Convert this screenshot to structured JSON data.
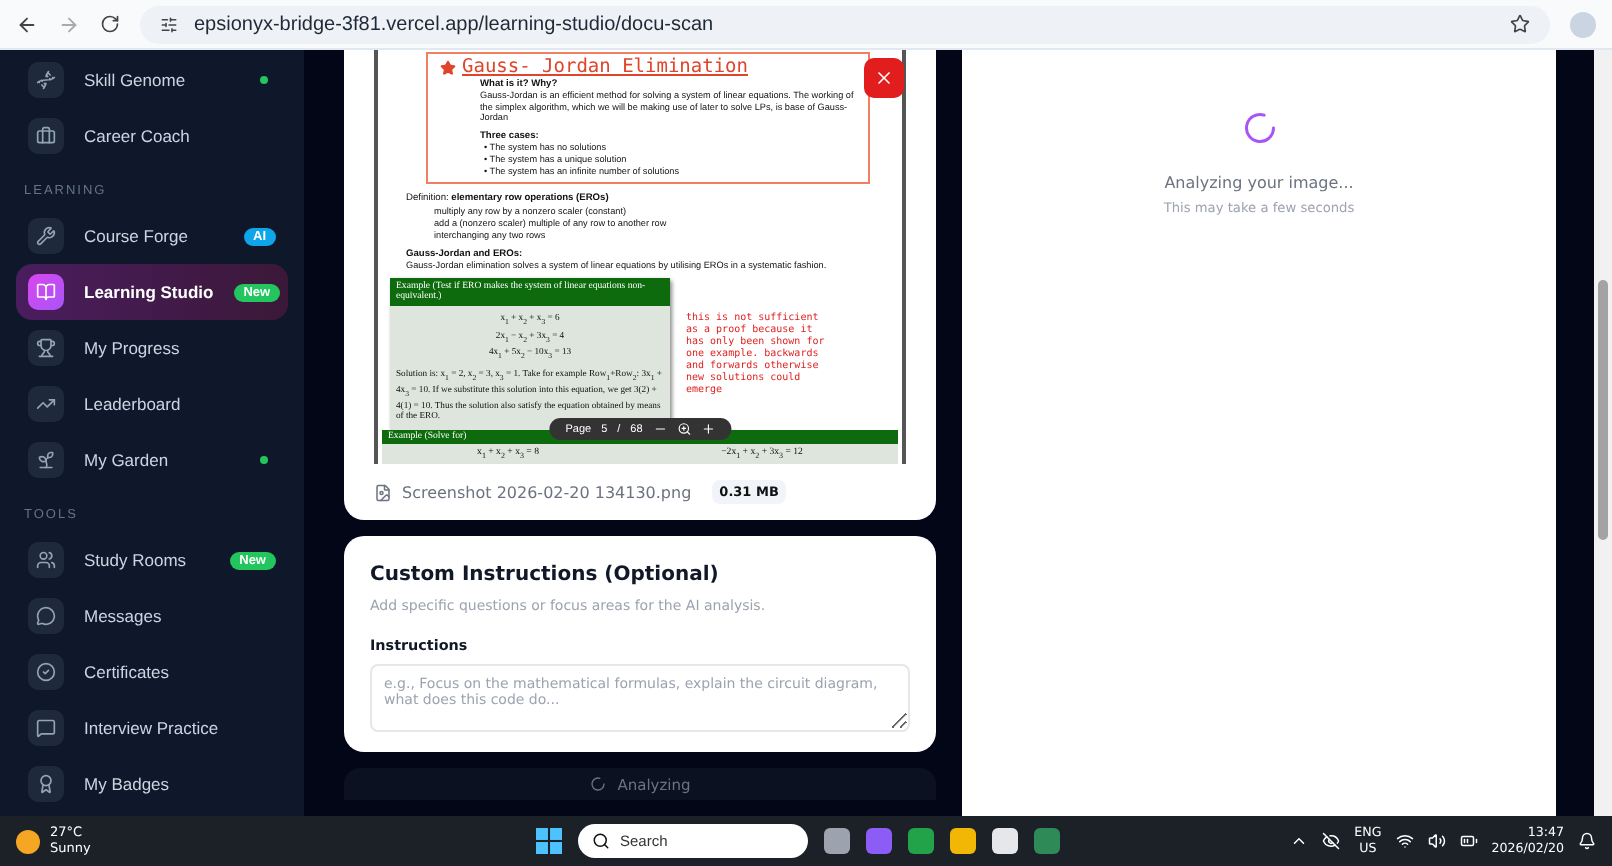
{
  "browser": {
    "url": "epsionyx-bridge-3f81.vercel.app/learning-studio/docu-scan"
  },
  "sidebar": {
    "items": [
      {
        "kind": "item",
        "label": "Skill Genome",
        "dot": true,
        "selected": false
      },
      {
        "kind": "item",
        "label": "Career Coach",
        "dot": false,
        "selected": false
      },
      {
        "kind": "section",
        "label": "LEARNING"
      },
      {
        "kind": "item",
        "label": "Course Forge",
        "badge": {
          "text": "AI",
          "color": "#0ea5e9"
        },
        "dot": false,
        "selected": false
      },
      {
        "kind": "item",
        "label": "Learning Studio",
        "badge": {
          "text": "New",
          "color": "#22c55e"
        },
        "dot": false,
        "selected": true
      },
      {
        "kind": "item",
        "label": "My Progress",
        "dot": false,
        "selected": false
      },
      {
        "kind": "item",
        "label": "Leaderboard",
        "dot": false,
        "selected": false
      },
      {
        "kind": "item",
        "label": "My Garden",
        "dot": true,
        "selected": false
      },
      {
        "kind": "section",
        "label": "TOOLS"
      },
      {
        "kind": "item",
        "label": "Study Rooms",
        "badge": {
          "text": "New",
          "color": "#22c55e"
        },
        "dot": false,
        "selected": false
      },
      {
        "kind": "item",
        "label": "Messages",
        "dot": false,
        "selected": false
      },
      {
        "kind": "item",
        "label": "Certificates",
        "dot": false,
        "selected": false
      },
      {
        "kind": "item",
        "label": "Interview Practice",
        "dot": false,
        "selected": false
      },
      {
        "kind": "item",
        "label": "My Badges",
        "dot": false,
        "selected": false
      }
    ]
  },
  "preview": {
    "document": {
      "title": "Gauss- Jordan Elimination",
      "intro_heading": "What is it? Why?",
      "intro": "Gauss-Jordan is an efficient method for solving a system of linear equations. The working of the simplex algorithm, which we will be making use of later to solve LPs, is base of Gauss-Jordan",
      "cases_heading": "Three cases:",
      "cases": [
        "• The system has no solutions",
        "• The system has a unique solution",
        "• The system has an infinite number of solutions"
      ],
      "definition": "Definition: **elementary row operations (EROs)**",
      "operations": [
        "multiply any row by a nonzero scaler (constant)",
        "add a (nonzero scaler) multiple of any row to another row",
        "interchanging any two rows"
      ],
      "gj_heading": "Gauss-Jordan and EROs:",
      "gj_text": "Gauss-Jordan elimination solves a system of linear equations by utilising EROs in a systematic fashion.",
      "example": {
        "header": "Example (Test if ERO makes the system of linear equations non-equivalent.)",
        "equations": [
          "x$_{1}$ + x$_{2}$ + x$_{3}$ = 6",
          "2x$_{1}$ − x$_{2}$ + 3x$_{3}$ = 4",
          "4x$_{1}$ + 5x$_{2}$ − 10x$_{3}$ = 13"
        ],
        "solution": "Solution is: x$_{1}$ = 2, x$_{2}$ = 3, x$_{3}$ = 1. Take for example Row$_{1}$+Row$_{2}$: 3x$_{1}$ + 4x$_{3}$ = 10. If we substitute this solution into this equation, we get 3(2) + 4(1) = 10. Thus the solution also satisfy the equation obtained by means of the ERO."
      },
      "note": "this is not sufficient as a proof because it has only been shown for one example. backwards and forwards otherwise new solutions could emerge",
      "example2": {
        "header": "Example (Solve for)",
        "equations": [
          "x$_{1}$ + x$_{2}$ + x$_{3}$ = 8",
          "−2x$_{1}$ + x$_{2}$ + 3x$_{3}$ = 12"
        ]
      }
    },
    "toolbar": {
      "page_label": "Page",
      "page": "5",
      "separator": "/",
      "total": "68"
    },
    "file": {
      "name": "Screenshot 2026-02-20 134130.png",
      "size": "0.31 MB"
    }
  },
  "custom_instructions": {
    "title": "Custom Instructions (Optional)",
    "description": "Add specific questions or focus areas for the AI analysis.",
    "label": "Instructions",
    "placeholder": "e.g., Focus on the mathematical formulas, explain the circuit diagram, what does this code do..."
  },
  "analyze_button": {
    "label": "Analyzing",
    "disabled": true
  },
  "status": {
    "title": "Analyzing your image...",
    "subtitle": "This may take a few seconds"
  },
  "taskbar": {
    "weather": {
      "temp": "27°C",
      "condition": "Sunny"
    },
    "search": {
      "placeholder": "Search"
    },
    "language": {
      "lang": "ENG",
      "region": "US"
    },
    "time": "13:47",
    "date": "2026/02/20"
  }
}
